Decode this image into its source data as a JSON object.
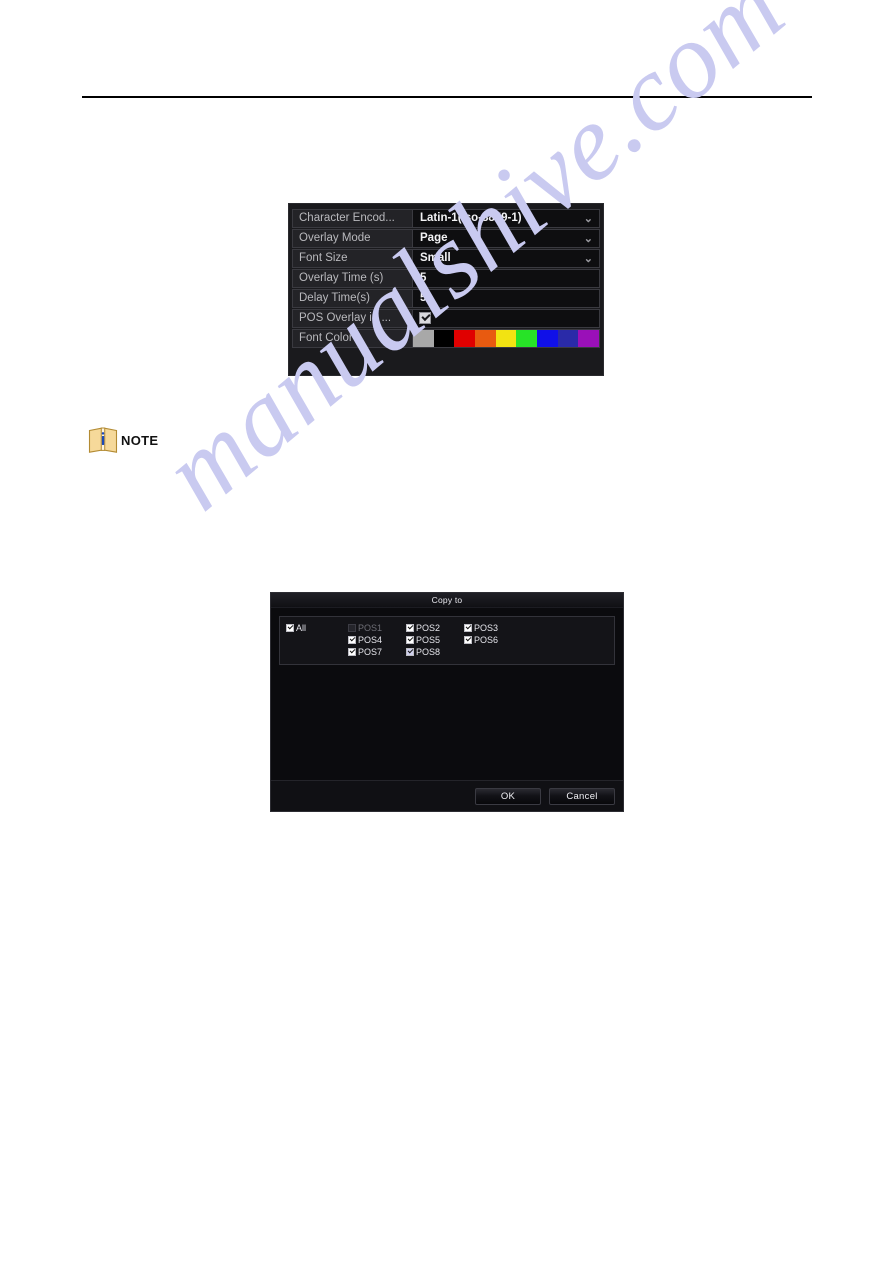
{
  "page": {
    "background_color": "#ffffff",
    "watermark_text": "manualshive.com",
    "watermark_color": "#c9caf0"
  },
  "settings_panel": {
    "name": "POS overlay settings",
    "rows": [
      {
        "label": "Character Encod...",
        "value": "Latin-1(iso-8859-1)",
        "type": "dropdown"
      },
      {
        "label": "Overlay Mode",
        "value": "Page",
        "type": "dropdown"
      },
      {
        "label": "Font Size",
        "value": "Small",
        "type": "dropdown"
      },
      {
        "label": "Overlay Time (s)",
        "value": "5",
        "type": "text"
      },
      {
        "label": "Delay Time(s)",
        "value": "5",
        "type": "text"
      },
      {
        "label": "POS Overlay in ...",
        "value": "",
        "type": "checkbox",
        "checked": true
      },
      {
        "label": "Font Color",
        "value": "",
        "type": "colorpicker"
      }
    ],
    "chevron_glyph": "⌄",
    "font_colors": [
      "#a8a8a8",
      "#000000",
      "#e00000",
      "#e85a10",
      "#f2e312",
      "#27e327",
      "#1010e8",
      "#2a2aa8",
      "#9a10b8"
    ]
  },
  "note": {
    "label": "NOTE",
    "icon": "note-book-icon"
  },
  "copy_dialog": {
    "title": "Copy to",
    "all": {
      "label": "All",
      "checked": true
    },
    "channels": [
      {
        "label": "POS1",
        "checked": false,
        "disabled": true,
        "tinted": false
      },
      {
        "label": "POS2",
        "checked": true,
        "disabled": false,
        "tinted": false
      },
      {
        "label": "POS3",
        "checked": true,
        "disabled": false,
        "tinted": false
      },
      {
        "label": "POS4",
        "checked": true,
        "disabled": false,
        "tinted": false
      },
      {
        "label": "POS5",
        "checked": true,
        "disabled": false,
        "tinted": false
      },
      {
        "label": "POS6",
        "checked": true,
        "disabled": false,
        "tinted": false
      },
      {
        "label": "POS7",
        "checked": true,
        "disabled": false,
        "tinted": false
      },
      {
        "label": "POS8",
        "checked": true,
        "disabled": false,
        "tinted": true
      }
    ],
    "ok_label": "OK",
    "cancel_label": "Cancel"
  }
}
